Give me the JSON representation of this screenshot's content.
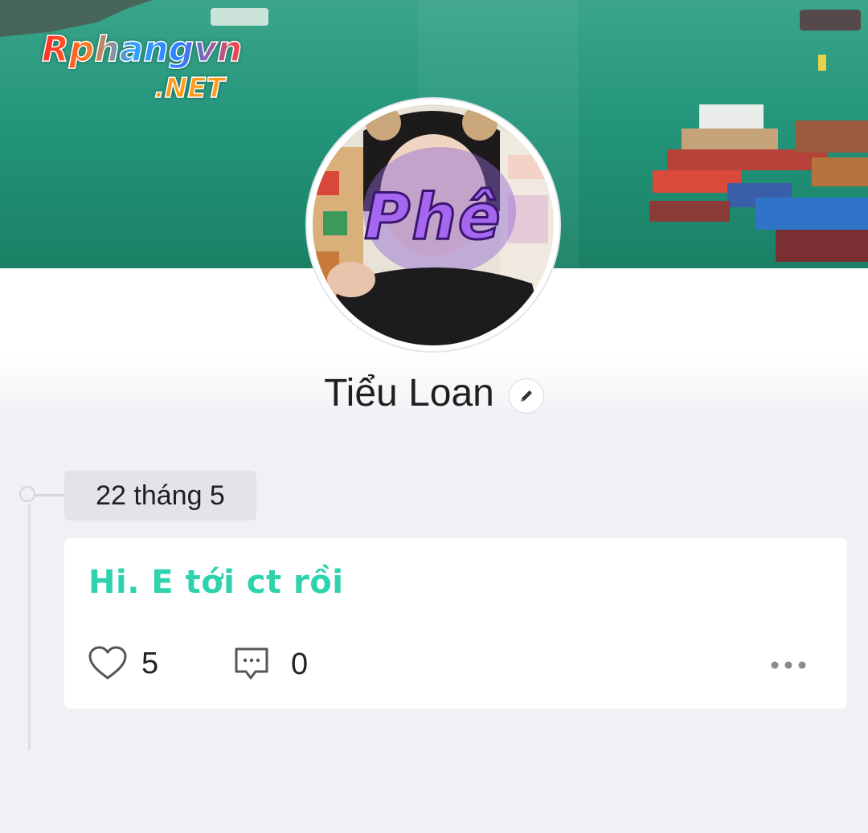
{
  "watermark": {
    "brand": "Rphangvn",
    "domain": ".NET"
  },
  "profile": {
    "avatar_overlay_text": "Phê",
    "name": "Tiểu Loan"
  },
  "timeline": {
    "date_label": "22 tháng 5"
  },
  "post": {
    "text": "Hi. E tới ct rồi",
    "like_count": "5",
    "comment_count": "0"
  },
  "icons": {
    "edit": "pencil-icon",
    "like": "heart-icon",
    "comment": "comment-icon",
    "more": "more-dots-icon"
  },
  "colors": {
    "post_text": "#2ed3ad",
    "background": "#f0f1f5",
    "card": "#ffffff",
    "date_chip": "#e2e4e9"
  }
}
